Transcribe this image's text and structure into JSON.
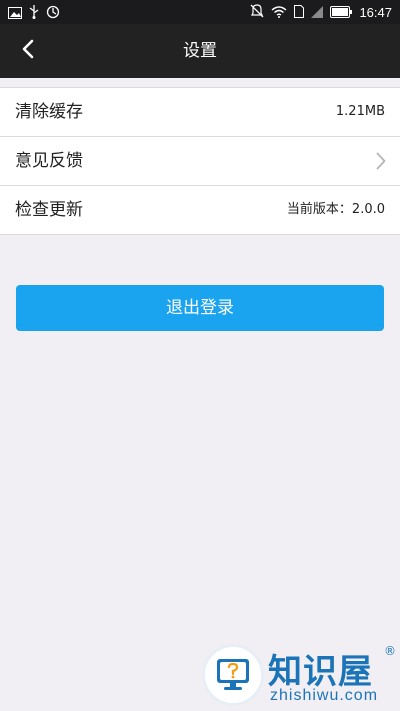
{
  "status_bar": {
    "time": "16:47",
    "left_icons": [
      "image-icon",
      "usb-icon",
      "sync-icon"
    ],
    "right_icons": [
      "mute-vibrate-icon",
      "wifi-icon",
      "sim-icon",
      "signal-icon",
      "battery-icon"
    ]
  },
  "nav": {
    "title": "设置",
    "back_icon": "chevron-left-icon"
  },
  "settings": {
    "items": [
      {
        "label": "清除缓存",
        "value": "1.21MB"
      },
      {
        "label": "意见反馈",
        "value": ""
      },
      {
        "label": "检查更新",
        "value": "当前版本：2.0.0"
      }
    ]
  },
  "logout": {
    "label": "退出登录"
  },
  "watermark": {
    "brand": "知识屋",
    "registered": "®",
    "url": "zhishiwu.com"
  },
  "colors": {
    "nav_background": "#222223",
    "page_background": "#f1eff4",
    "primary_button": "#1aa3ee",
    "watermark_blue": "#1b74b8"
  }
}
